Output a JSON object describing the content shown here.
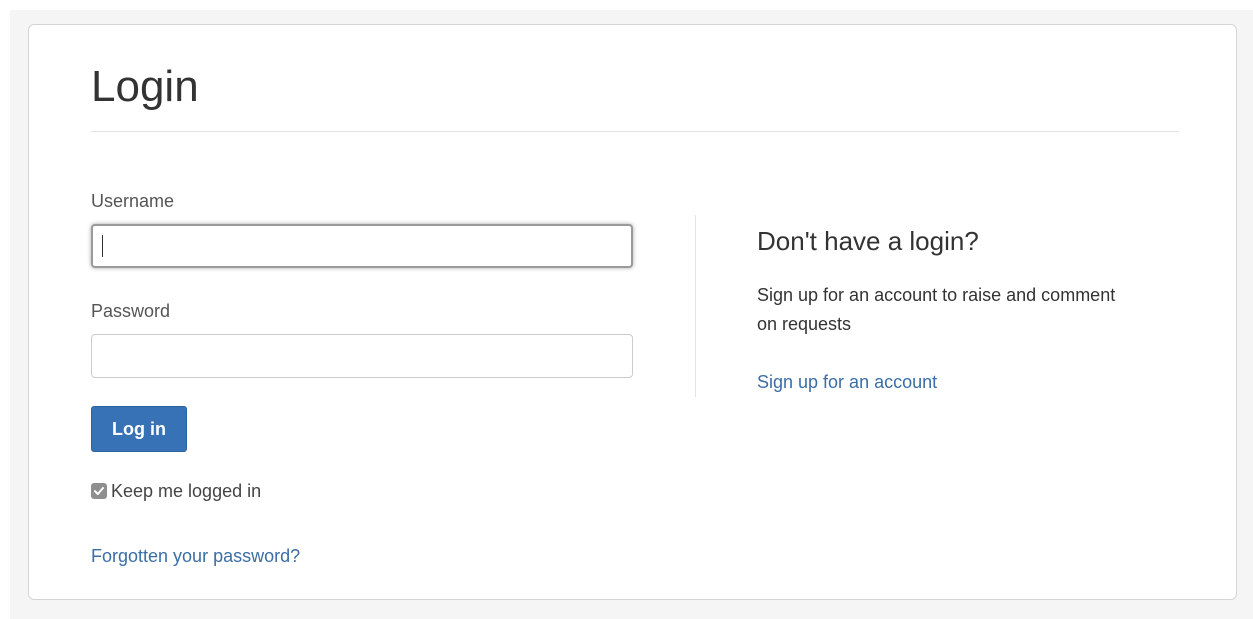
{
  "login_form": {
    "title": "Login",
    "username_label": "Username",
    "username_value": "",
    "password_label": "Password",
    "password_value": "",
    "submit_label": "Log in",
    "keep_logged_in_label": "Keep me logged in",
    "keep_logged_in_checked": true,
    "forgot_password_link": "Forgotten your password?"
  },
  "signup": {
    "heading": "Don't have a login?",
    "description": "Sign up for an account to raise and comment on requests",
    "link": "Sign up for an account"
  },
  "icons": {
    "checkbox": "checkmark-icon"
  },
  "colors": {
    "primary_button": "#3672b5",
    "link": "#3a6ea5",
    "checkbox": "#8f8f8f",
    "page_background": "#f5f5f5"
  }
}
